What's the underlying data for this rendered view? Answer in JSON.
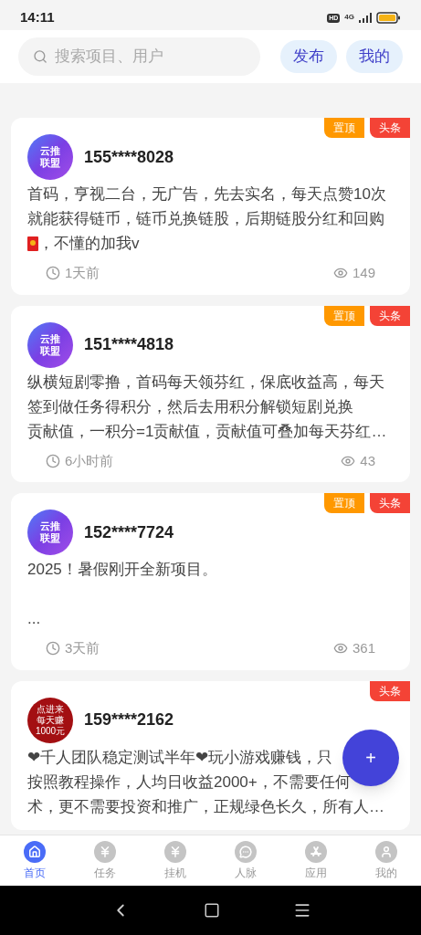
{
  "status_bar": {
    "time": "14:11",
    "hd": "HD",
    "network": "4G"
  },
  "header": {
    "search": {
      "placeholder": "搜索项目、用户"
    },
    "buttons": [
      "发布",
      "我的"
    ]
  },
  "posts": [
    {
      "avatar": {
        "kind": "logo",
        "lines": [
          "云推",
          "联盟"
        ]
      },
      "user": "155****8028",
      "tags": [
        {
          "text": "置顶",
          "color": "#ff9800"
        },
        {
          "text": "头条",
          "color": "#f44336"
        }
      ],
      "lines": [
        {
          "text": "首码，亨视二台，无广告，先去实名，每天点赞10次"
        },
        {
          "text": "就能获得链币，链币兑换链股，后期链股分红和回购"
        },
        {
          "text": "，不懂的加我v",
          "red_envelope": true
        }
      ],
      "time": "1天前",
      "views": "149"
    },
    {
      "avatar": {
        "kind": "logo",
        "lines": [
          "云推",
          "联盟"
        ]
      },
      "user": "151****4818",
      "tags": [
        {
          "text": "置顶",
          "color": "#ff9800"
        },
        {
          "text": "头条",
          "color": "#f44336"
        }
      ],
      "lines": [
        {
          "text": "纵横短剧零撸，首码每天领芬红，保底收益高，每天"
        },
        {
          "text": "签到做任务得积分，然后去用积分解锁短剧兑换"
        },
        {
          "text": "贡献值，一积分=1贡献值，贡献值可叠加每天芬红…"
        }
      ],
      "time": "6小时前",
      "views": "43"
    },
    {
      "avatar": {
        "kind": "logo",
        "lines": [
          "云推",
          "联盟"
        ]
      },
      "user": "152****7724",
      "tags": [
        {
          "text": "置顶",
          "color": "#ff9800"
        },
        {
          "text": "头条",
          "color": "#f44336"
        }
      ],
      "lines": [
        {
          "text": "2025！暑假刚开全新项目。"
        },
        {
          "text": "...",
          "blank_before": true
        }
      ],
      "time": "3天前",
      "views": "361"
    },
    {
      "avatar": {
        "kind": "promo",
        "lines": [
          "点进来",
          "每天赚",
          "1000元"
        ]
      },
      "user": "159****2162",
      "tags": [
        {
          "text": "头条",
          "color": "#f44336"
        }
      ],
      "lines": [
        {
          "text": "❤千人团队稳定测试半年❤玩小游戏赚钱，只"
        },
        {
          "text": "按照教程操作，人均日收益2000+，不需要任何"
        },
        {
          "text": "术，更不需要投资和推广，正规绿色长久，所有人…"
        }
      ]
    }
  ],
  "fab": "+",
  "tabs": [
    {
      "kind": "home",
      "label": "首页",
      "selected": true
    },
    {
      "kind": "yen",
      "label": "任务",
      "selected": false
    },
    {
      "kind": "yen",
      "label": "挂机",
      "selected": false
    },
    {
      "kind": "chat",
      "label": "人脉",
      "selected": false
    },
    {
      "kind": "app",
      "label": "应用",
      "selected": false
    },
    {
      "kind": "person",
      "label": "我的",
      "selected": false
    }
  ]
}
